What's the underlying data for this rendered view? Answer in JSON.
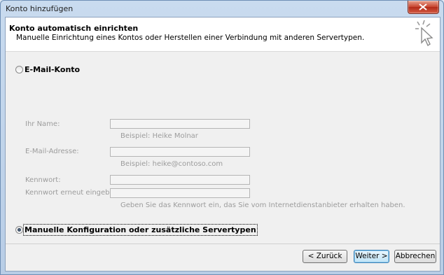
{
  "window": {
    "title": "Konto hinzufügen"
  },
  "header": {
    "title": "Konto automatisch einrichten",
    "subtitle": "Manuelle Einrichtung eines Kontos oder Herstellen einer Verbindung mit anderen Servertypen."
  },
  "options": {
    "email_account": {
      "label": "E-Mail-Konto",
      "selected": false
    },
    "manual": {
      "label": "Manuelle Konfiguration oder zusätzliche Servertypen",
      "selected": true
    }
  },
  "form": {
    "name_label": "Ihr Name:",
    "name_hint": "Beispiel: Heike Molnar",
    "email_label": "E-Mail-Adresse:",
    "email_hint": "Beispiel: heike@contoso.com",
    "password_label": "Kennwort:",
    "password_repeat_label": "Kennwort erneut eingeben:",
    "password_hint": "Geben Sie das Kennwort ein, das Sie vom Internetdienstanbieter erhalten haben."
  },
  "buttons": {
    "back": "< Zurück",
    "next": "Weiter >",
    "cancel": "Abbrechen"
  },
  "icons": {
    "wizard": "cursor-sparkle-icon",
    "close": "close-icon"
  }
}
